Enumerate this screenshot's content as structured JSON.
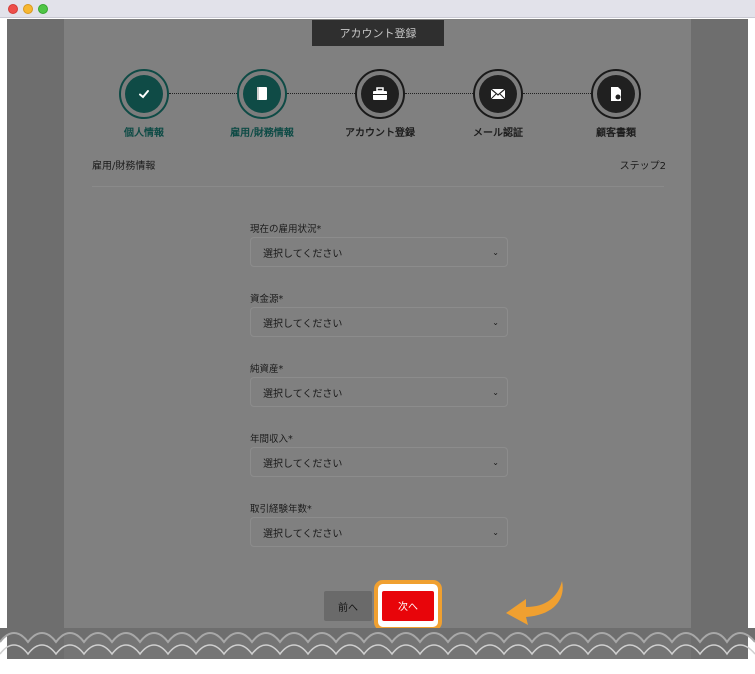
{
  "page": {
    "header": "アカウント登録",
    "section_title": "雇用/財務情報",
    "step_indicator": "ステップ2"
  },
  "steps": [
    {
      "label": "個人情報",
      "icon": "check-icon",
      "state": "done"
    },
    {
      "label": "雇用/財務情報",
      "icon": "book-icon",
      "state": "active"
    },
    {
      "label": "アカウント登録",
      "icon": "briefcase-icon",
      "state": "pending"
    },
    {
      "label": "メール認証",
      "icon": "envelope-icon",
      "state": "pending"
    },
    {
      "label": "顧客書類",
      "icon": "document-icon",
      "state": "pending"
    }
  ],
  "fields": [
    {
      "label": "現在の雇用状況*",
      "placeholder": "選択してください"
    },
    {
      "label": "資金源*",
      "placeholder": "選択してください"
    },
    {
      "label": "純資産*",
      "placeholder": "選択してください"
    },
    {
      "label": "年間収入*",
      "placeholder": "選択してください"
    },
    {
      "label": "取引経験年数*",
      "placeholder": "選択してください"
    }
  ],
  "buttons": {
    "prev": "前へ",
    "next": "次へ"
  },
  "colors": {
    "accent_teal": "#0f4b46",
    "next_button": "#e8050a",
    "highlight": "#f0a030"
  }
}
